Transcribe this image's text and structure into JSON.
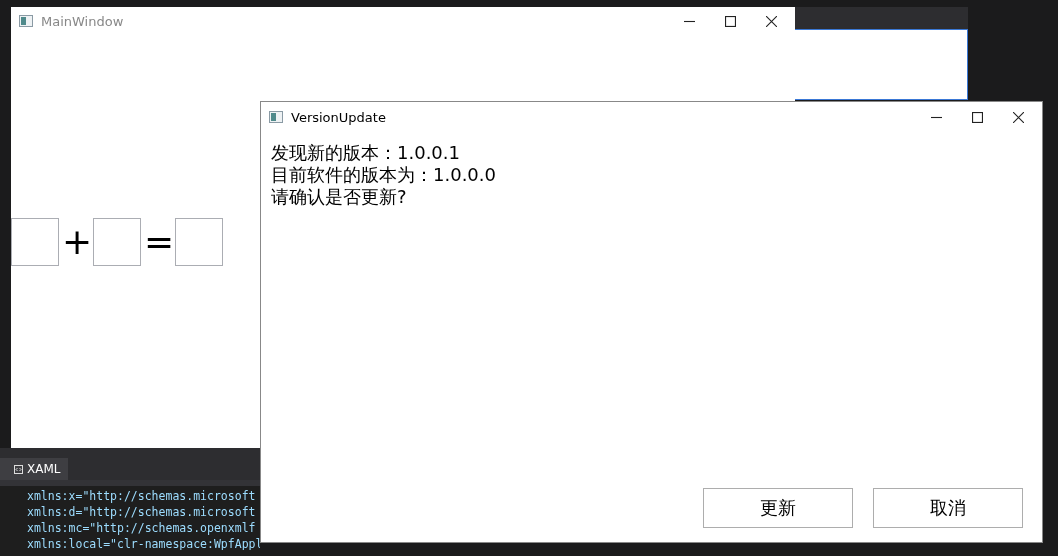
{
  "main_window": {
    "title": "MainWindow",
    "equation": [
      {
        "kind": "field"
      },
      {
        "kind": "operator",
        "text": "+"
      },
      {
        "kind": "field"
      },
      {
        "kind": "operator",
        "text": "="
      },
      {
        "kind": "field"
      }
    ]
  },
  "ide": {
    "tab": "XAML",
    "code_lines": [
      "xmlns:x=\"http://schemas.microsoft",
      "xmlns:d=\"http://schemas.microsoft",
      "xmlns:mc=\"http://schemas.openxmlf",
      "xmlns:local=\"clr-namespace:WpfAppl"
    ]
  },
  "dialog": {
    "title": "VersionUpdate",
    "lines": [
      "发现新的版本：1.0.0.1",
      "目前软件的版本为：1.0.0.0",
      "请确认是否更新?"
    ],
    "buttons": [
      "更新",
      "取消"
    ]
  }
}
